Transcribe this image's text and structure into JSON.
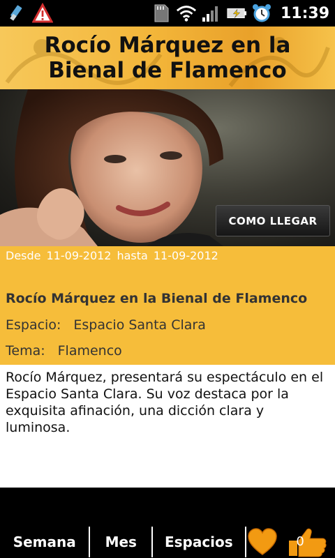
{
  "status_bar": {
    "time": "11:39",
    "icons": [
      "usb-icon",
      "warning-icon",
      "sdcard-icon",
      "wifi-icon",
      "signal-icon",
      "battery-charging-icon",
      "alarm-icon"
    ]
  },
  "header": {
    "title": "Rocío Márquez en la Bienal de Flamenco"
  },
  "hero": {
    "route_button_label": "COMO LLEGAR"
  },
  "info": {
    "from_label": "Desde",
    "from_date": "11-09-2012",
    "to_label": "hasta",
    "to_date": "11-09-2012",
    "event_title": "Rocío Márquez en la Bienal de Flamenco",
    "space_label": "Espacio:",
    "space_value": "Espacio Santa Clara",
    "topic_label": "Tema:",
    "topic_value": "Flamenco"
  },
  "description": "Rocío Márquez, presentará su espectáculo en el Espacio Santa Clara. Su voz destaca por la exquisita afinación, una dicción clara y luminosa.",
  "bottom_bar": {
    "tabs": [
      {
        "label": "Semana"
      },
      {
        "label": "Mes"
      },
      {
        "label": "Espacios"
      }
    ],
    "like_count": "0"
  },
  "colors": {
    "accent": "#f6bd3a",
    "status_bg": "#000000"
  }
}
